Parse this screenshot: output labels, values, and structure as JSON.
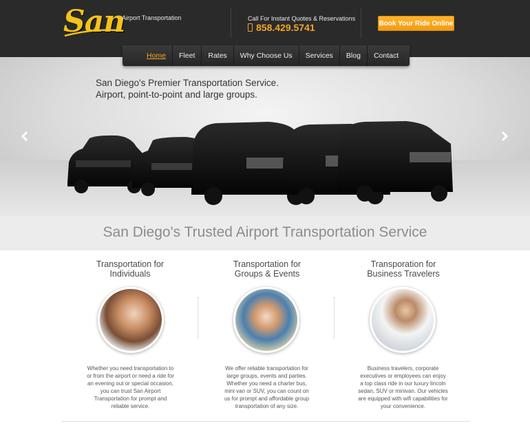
{
  "header": {
    "logo_text": "San",
    "tagline": "Airport Transportation",
    "call_label": "Call For Instant Quotes & Reservations",
    "phone": "858.429.5741",
    "book_button": "Book Your Ride Online"
  },
  "nav": {
    "items": [
      "Home",
      "Fleet",
      "Rates",
      "Why Choose Us",
      "Services",
      "Blog",
      "Contact"
    ],
    "active": "Home"
  },
  "hero": {
    "line1": "San Diego's Premier Transportation Service.",
    "line2": "Airport, point-to-point and large groups.",
    "prev_icon": "chevron-left-icon",
    "next_icon": "chevron-right-icon"
  },
  "band": {
    "title": "San Diego's Trusted Airport Transportation Service"
  },
  "columns": [
    {
      "title_line1": "Transportation for",
      "title_line2": "Individuals",
      "text": "Whether you need transportation to or from the airport or need a ride for an evening out or special occasion, you can trust San Airport Transportation for prompt and reliable service."
    },
    {
      "title_line1": "Transportation for",
      "title_line2": "Groups & Events",
      "text": "We offer reliable transportation for large groups, events and parties. Whether you need a charter bus, mini van or SUV, you can count on us for prompt and affordable group transportation of any size."
    },
    {
      "title_line1": "Transporation for",
      "title_line2": "Business Travelers",
      "text": "Business travelers, corporate executives or employees can enjoy a top class ride in our luxury lincoln sedan, SUV or minivan. Our vehicles are equipped with wifi capabilities for your convenience."
    }
  ],
  "colors": {
    "accent": "#f4a724",
    "header_bg": "#2a2a2a",
    "logo": "#f4c21b"
  }
}
